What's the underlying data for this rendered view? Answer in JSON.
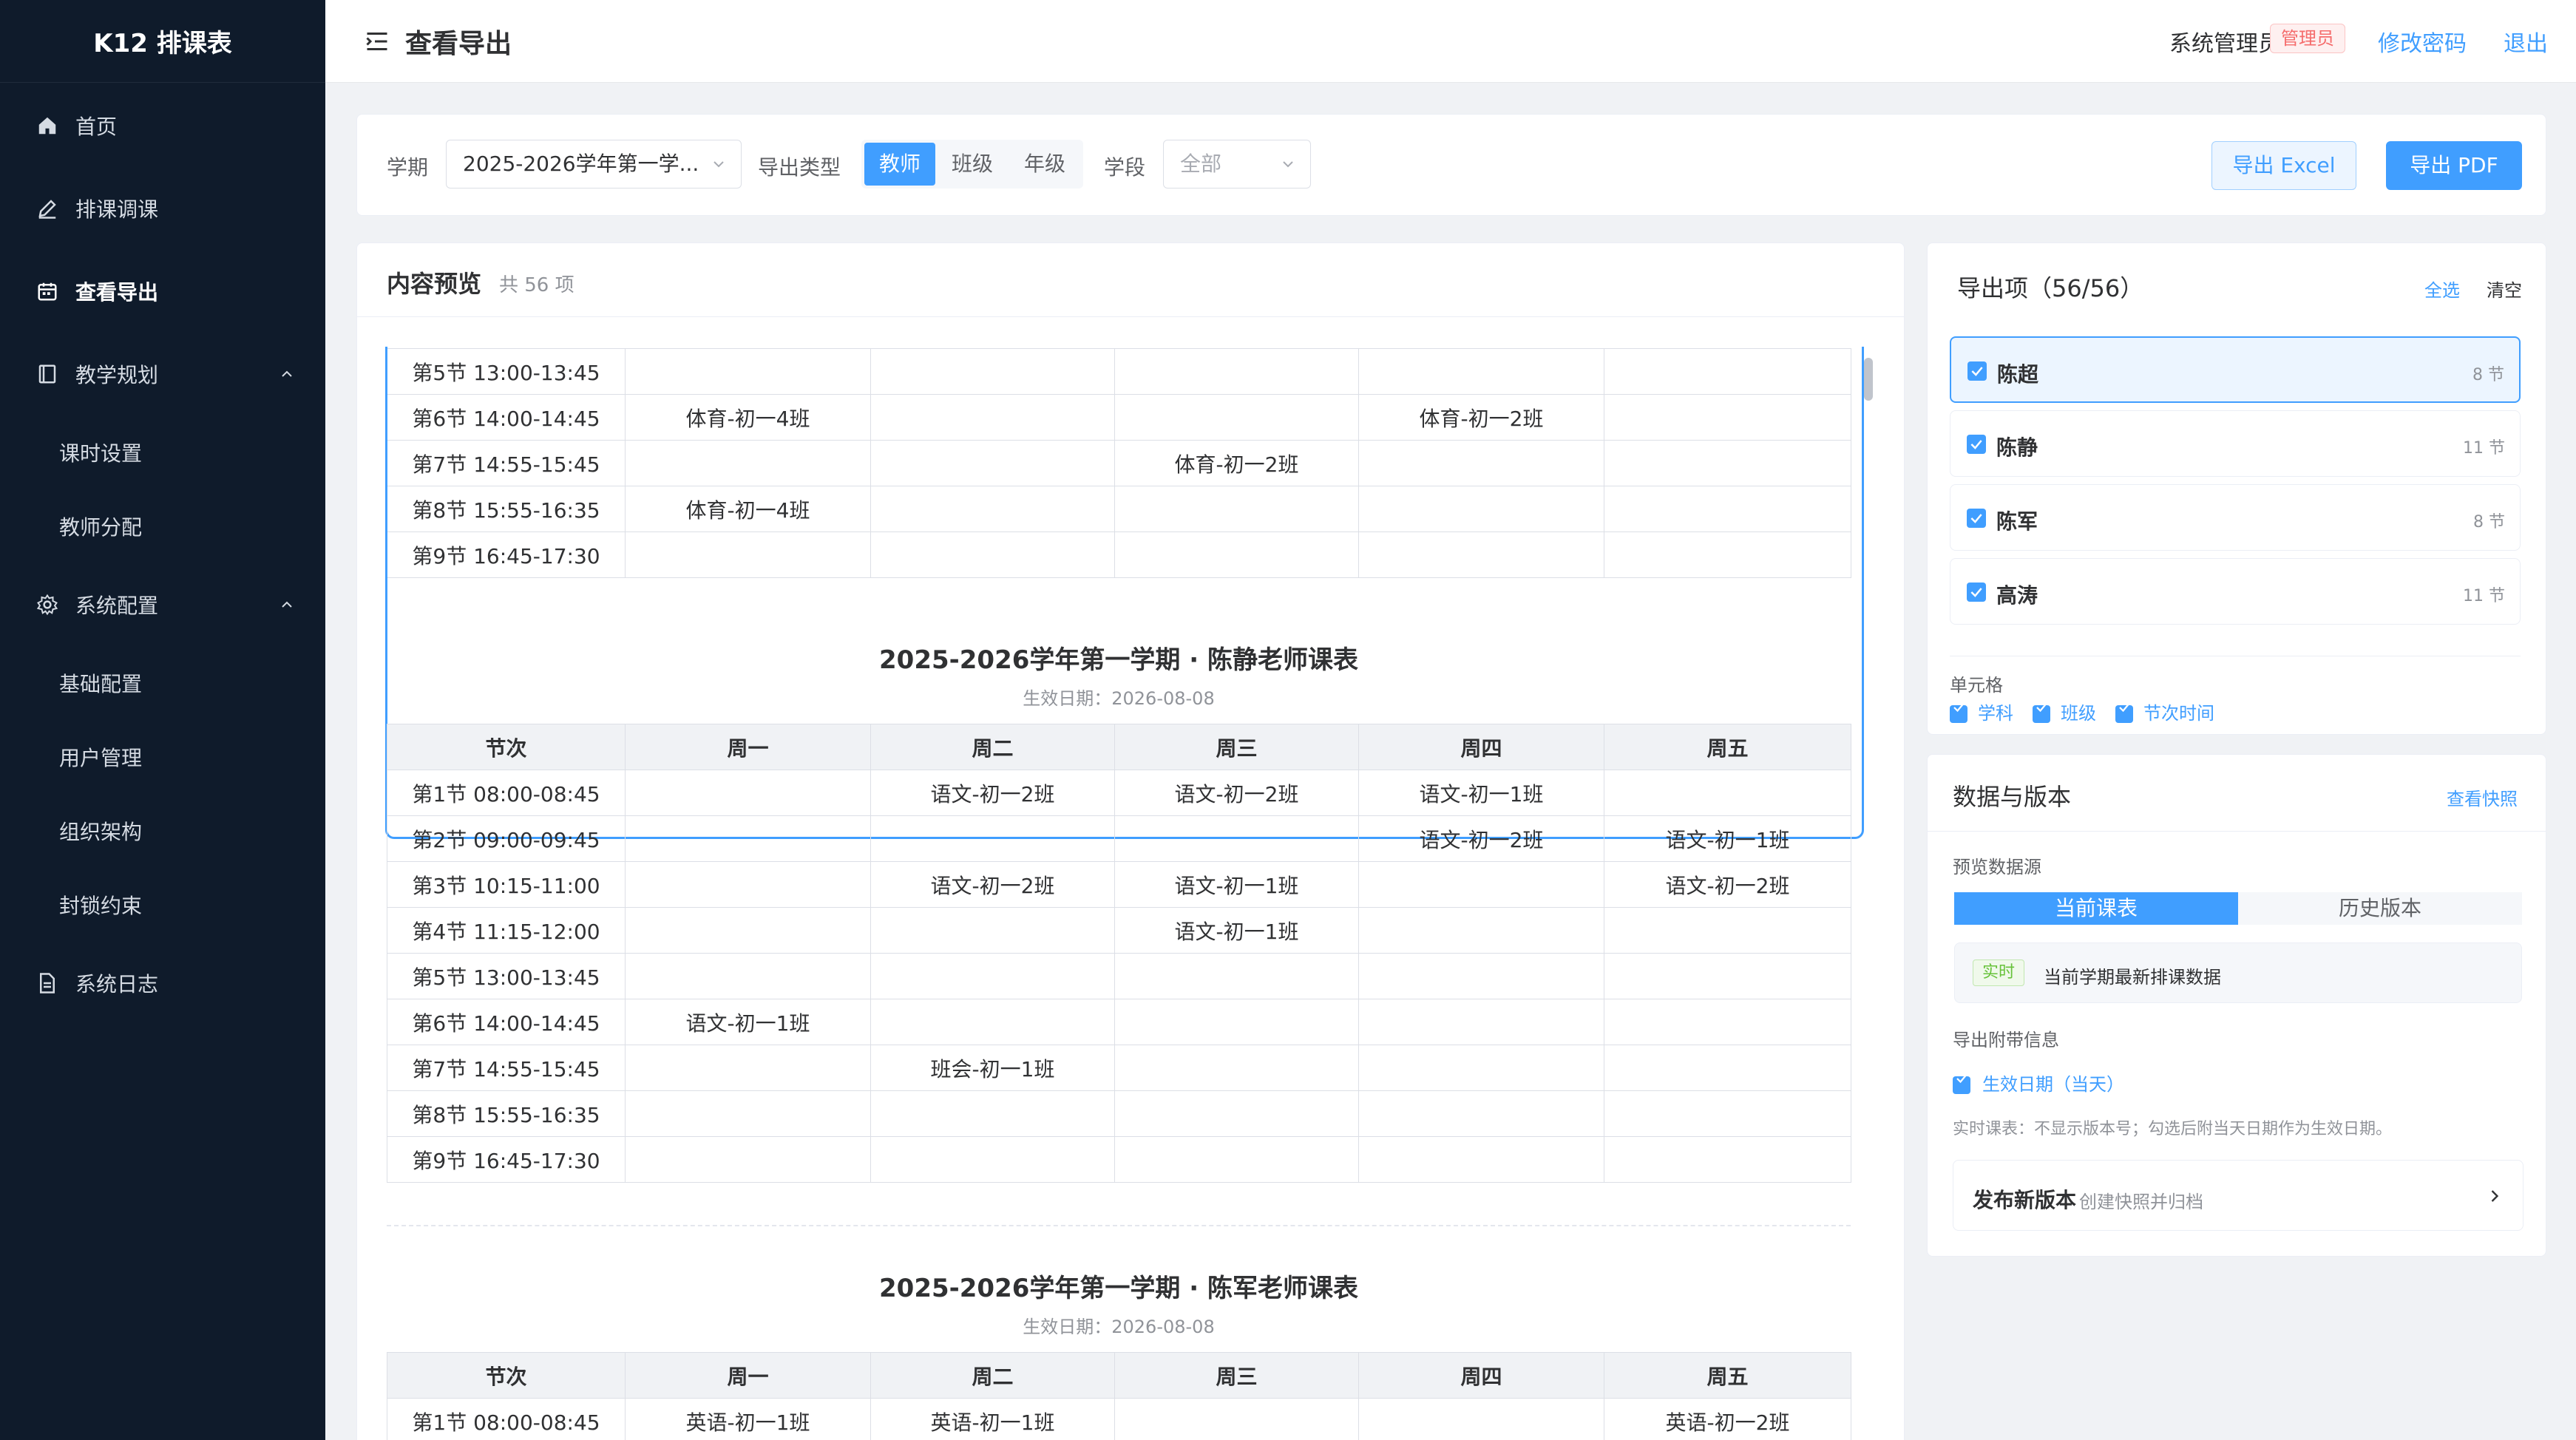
{
  "app": {
    "brand": "K12 排课表"
  },
  "nav": {
    "home": "首页",
    "schedule": "排课调课",
    "export": "查看导出",
    "teaching": "教学规划",
    "period_settings": "课时设置",
    "teacher_assign": "教师分配",
    "system": "系统配置",
    "base_config": "基础配置",
    "user_mgmt": "用户管理",
    "org": "组织架构",
    "lock": "封锁约束",
    "logs": "系统日志"
  },
  "header": {
    "title": "查看导出",
    "user": "系统管理员",
    "role": "管理员",
    "change_password": "修改密码",
    "logout": "退出"
  },
  "filter": {
    "term_label": "学期",
    "term_value": "2025-2026学年第一学...",
    "type_label": "导出类型",
    "types": [
      "教师",
      "班级",
      "年级"
    ],
    "type_active": "教师",
    "stage_label": "学段",
    "stage_value": "全部",
    "export_excel": "导出 Excel",
    "export_pdf": "导出 PDF"
  },
  "preview": {
    "title": "内容预览",
    "count": "共 56 项",
    "sheet1_rows": [
      [
        "第5节 13:00-13:45",
        "",
        "",
        "",
        "",
        ""
      ],
      [
        "第6节 14:00-14:45",
        "体育-初一4班",
        "",
        "",
        "体育-初一2班",
        ""
      ],
      [
        "第7节 14:55-15:45",
        "",
        "",
        "体育-初一2班",
        "",
        ""
      ],
      [
        "第8节 15:55-16:35",
        "体育-初一4班",
        "",
        "",
        "",
        ""
      ],
      [
        "第9节 16:45-17:30",
        "",
        "",
        "",
        "",
        ""
      ]
    ],
    "headers": [
      "节次",
      "周一",
      "周二",
      "周三",
      "周四",
      "周五"
    ],
    "sheet2": {
      "title": "2025-2026学年第一学期 · 陈静老师课表",
      "subtitle": "生效日期：2026-08-08",
      "rows": [
        [
          "第1节 08:00-08:45",
          "",
          "语文-初一2班",
          "语文-初一2班",
          "语文-初一1班",
          ""
        ],
        [
          "第2节 09:00-09:45",
          "",
          "",
          "",
          "语文-初一2班",
          "语文-初一1班"
        ],
        [
          "第3节 10:15-11:00",
          "",
          "语文-初一2班",
          "语文-初一1班",
          "",
          "语文-初一2班"
        ],
        [
          "第4节 11:15-12:00",
          "",
          "",
          "语文-初一1班",
          "",
          ""
        ],
        [
          "第5节 13:00-13:45",
          "",
          "",
          "",
          "",
          ""
        ],
        [
          "第6节 14:00-14:45",
          "语文-初一1班",
          "",
          "",
          "",
          ""
        ],
        [
          "第7节 14:55-15:45",
          "",
          "班会-初一1班",
          "",
          "",
          ""
        ],
        [
          "第8节 15:55-16:35",
          "",
          "",
          "",
          "",
          ""
        ],
        [
          "第9节 16:45-17:30",
          "",
          "",
          "",
          "",
          ""
        ]
      ]
    },
    "sheet3": {
      "title": "2025-2026学年第一学期 · 陈军老师课表",
      "subtitle": "生效日期：2026-08-08",
      "rows": [
        [
          "第1节 08:00-08:45",
          "英语-初一1班",
          "英语-初一1班",
          "",
          "",
          "英语-初一2班"
        ]
      ]
    }
  },
  "export_items": {
    "title": "导出项（56/56）",
    "select_all": "全选",
    "clear": "清空",
    "teachers": [
      {
        "name": "陈超",
        "count": "8 节"
      },
      {
        "name": "陈静",
        "count": "11 节"
      },
      {
        "name": "陈军",
        "count": "8 节"
      },
      {
        "name": "高涛",
        "count": "11 节"
      }
    ],
    "cell_label": "单元格",
    "cell_options": [
      "学科",
      "班级",
      "节次时间"
    ]
  },
  "data_version": {
    "title": "数据与版本",
    "view_snapshot": "查看快照",
    "source_label": "预览数据源",
    "tabs": [
      "当前课表",
      "历史版本"
    ],
    "live_tag": "实时",
    "live_text": "当前学期最新排课数据",
    "attach_label": "导出附带信息",
    "attach_option": "生效日期（当天）",
    "note": "实时课表：不显示版本号；勾选后附当天日期作为生效日期。",
    "publish_title": "发布新版本",
    "publish_sub": "创建快照并归档"
  },
  "colors": {
    "primary": "#409eff",
    "sidebar": "#0f1b2b",
    "danger": "#f56c6c",
    "success": "#67c23a"
  }
}
